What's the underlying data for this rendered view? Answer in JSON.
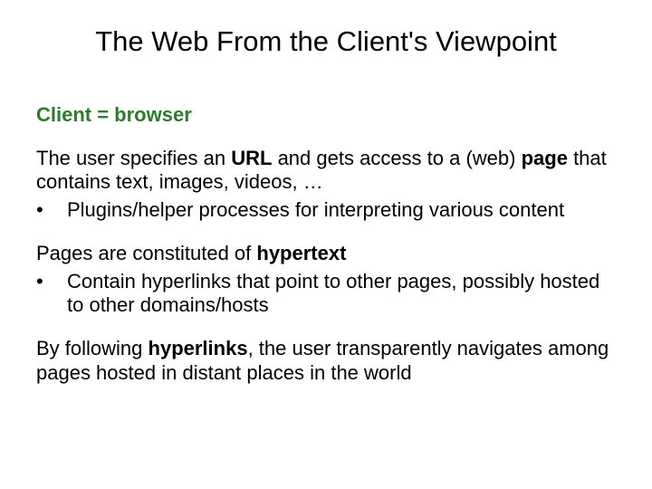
{
  "title": "The Web From the Client's Viewpoint",
  "subheading": "Client = browser",
  "p1_a": "The user specifies an ",
  "p1_b": "URL",
  "p1_c": " and gets access to a (web) ",
  "p1_d": "page",
  "p1_e": " that contains text, images, videos, …",
  "bullet1": "Plugins/helper processes for interpreting various content",
  "p2_a": "Pages are constituted of ",
  "p2_b": "hypertext",
  "bullet2": "Contain hyperlinks that point to other pages, possibly hosted to other domains/hosts",
  "p3_a": "By following ",
  "p3_b": "hyperlinks",
  "p3_c": ", the user transparently navigates among pages hosted in distant places in the world",
  "bullet_mark": "•"
}
